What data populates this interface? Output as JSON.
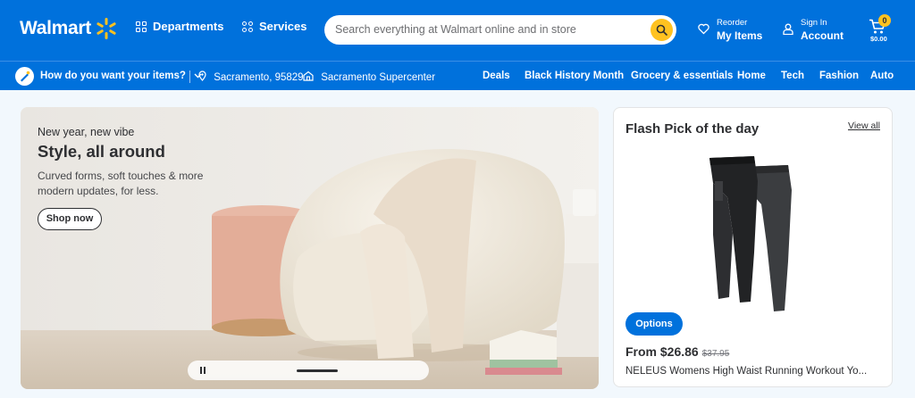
{
  "header": {
    "logo": "Walmart",
    "departments": "Departments",
    "services": "Services",
    "search_placeholder": "Search everything at Walmart online and in store",
    "reorder_small": "Reorder",
    "reorder_big": "My Items",
    "signin_small": "Sign In",
    "signin_big": "Account",
    "cart_count": "0",
    "cart_total": "$0.00"
  },
  "subnav": {
    "delivery_question": "How do you want your items?",
    "location": "Sacramento, 95829",
    "store": "Sacramento Supercenter",
    "links": [
      "Deals",
      "Black History Month",
      "Grocery & essentials",
      "Home",
      "Tech",
      "Fashion",
      "Auto"
    ]
  },
  "hero": {
    "kicker": "New year, new vibe",
    "title": "Style, all around",
    "description": "Curved forms, soft touches & more modern updates, for less.",
    "cta": "Shop now"
  },
  "flash_pick": {
    "title": "Flash Pick of the day",
    "view_all": "View all",
    "options_label": "Options",
    "price": "From $26.86",
    "old_price": "$37.95",
    "product_name": "NELEUS Womens High Waist Running Workout Yo..."
  },
  "colors": {
    "brand_blue": "#0071dc",
    "spark_yellow": "#ffc220"
  },
  "icons": {
    "search": "search-icon",
    "heart": "heart-icon",
    "user": "user-icon",
    "cart": "cart-icon",
    "location": "location-pin-icon",
    "store": "store-icon",
    "pause": "pause-icon"
  }
}
